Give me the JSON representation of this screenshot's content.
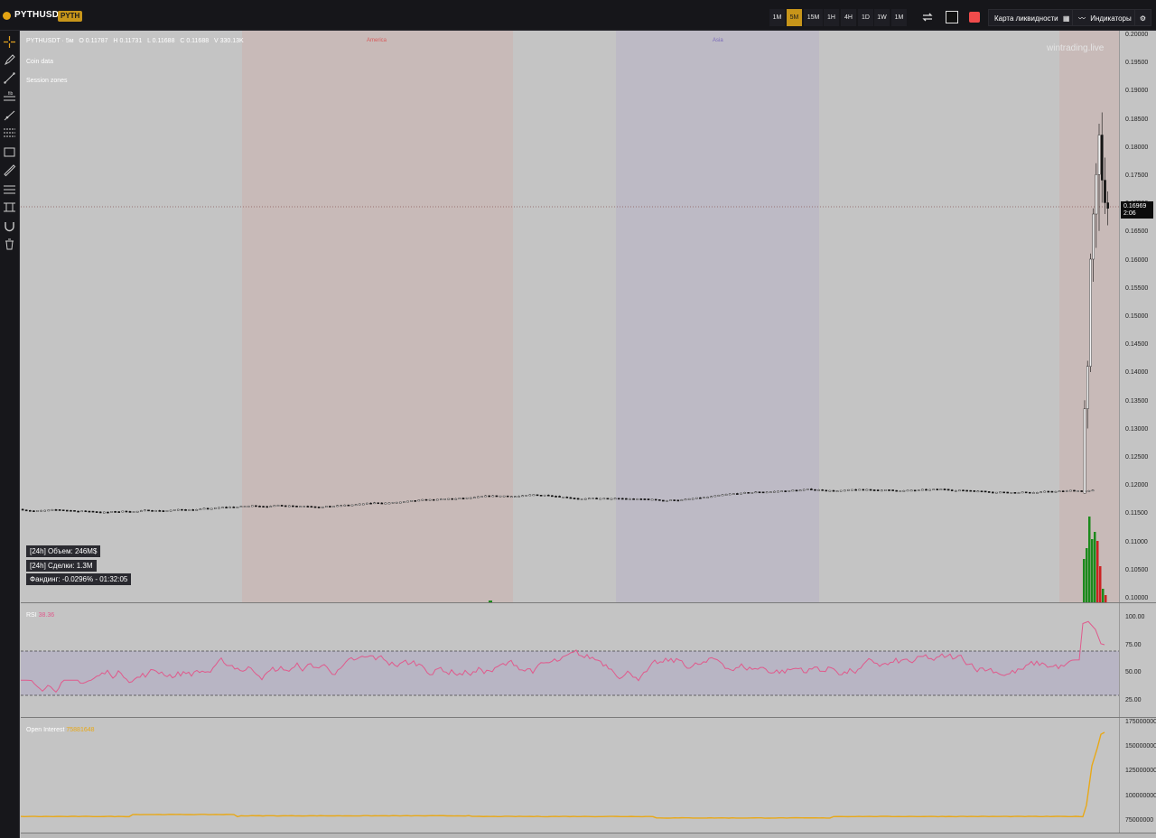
{
  "header": {
    "pair": "PYTHUSDT",
    "tag": "PYTH",
    "timeframes": [
      "1M",
      "5M",
      "15M",
      "1H",
      "4H",
      "1D",
      "1W",
      "1M"
    ],
    "active_timeframe_index": 1,
    "liquidity_map_label": "Карта ликвидности",
    "indicators_label": "Индикаторы",
    "accent_color": "#c7951a",
    "record_color": "#f04b4b"
  },
  "toolbar": {
    "icons": [
      "crosshair-icon",
      "brush-icon",
      "trend-line-icon",
      "fib-levels-icon",
      "ray-icon",
      "parallel-channel-icon",
      "rectangle-icon",
      "ruler-icon",
      "horizontal-levels-icon",
      "price-range-icon",
      "magnet-icon",
      "trash-icon"
    ]
  },
  "main": {
    "legend": {
      "symbol": "PYTHUSDT · 5м",
      "o_label": "O",
      "o": "0.11787",
      "h_label": "H",
      "h": "0.11731",
      "l_label": "L",
      "l": "0.11688",
      "c_label": "C",
      "c": "0.11688",
      "v_label": "V",
      "v": "330.13K"
    },
    "indicators": [
      "Coin data",
      "Session zones"
    ],
    "watermark": "wintrading.live",
    "sessions": [
      {
        "name": "America",
        "color": "#d85a5a"
      },
      {
        "name": "Asia",
        "color": "#7a6ab8"
      }
    ],
    "info": [
      "[24h] Объем: 246M$",
      "[24h] Сделки: 1.3M",
      "Фандинг: -0.0296% - 01:32:05"
    ],
    "price_box": {
      "price": "0.16969",
      "countdown": "2:06"
    },
    "price_ticks": [
      "0.20000",
      "0.19500",
      "0.19000",
      "0.18500",
      "0.18000",
      "0.17500",
      "0.17000",
      "0.16500",
      "0.16000",
      "0.15500",
      "0.15000",
      "0.14500",
      "0.14000",
      "0.13500",
      "0.13000",
      "0.12500",
      "0.12000",
      "0.11500",
      "0.11000",
      "0.10500",
      "0.10000"
    ]
  },
  "rsi": {
    "label": "RSI",
    "value": "38.36",
    "color": "#e05a8c",
    "ticks": [
      "100.00",
      "75.00",
      "50.00",
      "25.00"
    ]
  },
  "oi": {
    "label": "Open Interest",
    "value": "75881648",
    "color": "#e8a817",
    "ticks": [
      "175000000",
      "150000000",
      "125000000",
      "100000000",
      "75000000"
    ]
  }
}
